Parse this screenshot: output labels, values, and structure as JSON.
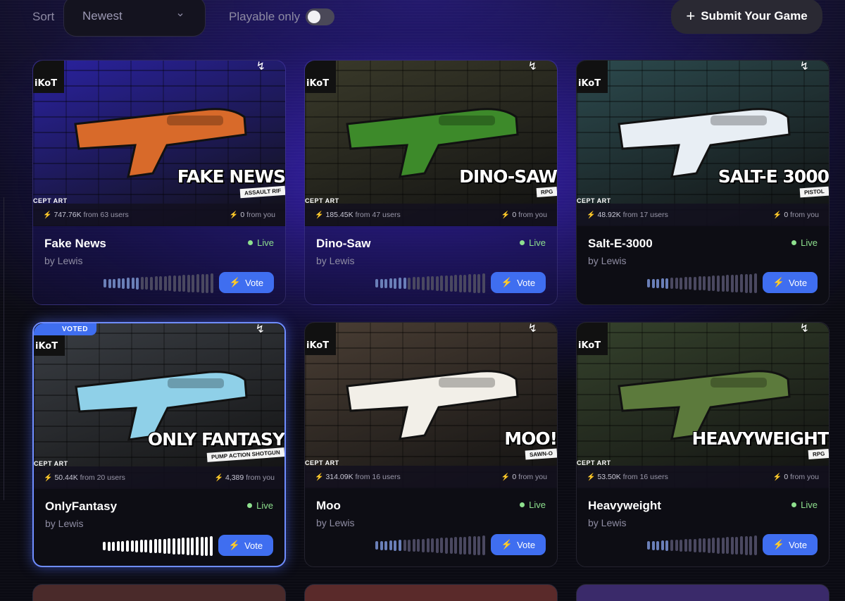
{
  "toolbar": {
    "sort_label": "Sort",
    "sort_value": "Newest",
    "playable_label": "Playable only",
    "playable_on": false,
    "submit_label": "Submit Your Game"
  },
  "cards": [
    {
      "title": "Fake News",
      "author": "by Lewis",
      "status": "Live",
      "art_title": "FAKE NEWS",
      "art_subtitle": "ASSAULT RIF",
      "corner_text": "CEPT ART",
      "stat_total": "747.76K",
      "stat_users": "from 63 users",
      "stat_you": "0",
      "stat_you_label": "from you",
      "vote_label": "Vote",
      "voted": false,
      "vote_level": 0.35,
      "bg": "#2a22a0"
    },
    {
      "title": "Dino-Saw",
      "author": "by Lewis",
      "status": "Live",
      "art_title": "DINO-SAW",
      "art_subtitle": "RPG",
      "corner_text": "CEPT ART",
      "stat_total": "185.45K",
      "stat_users": "from 47 users",
      "stat_you": "0",
      "stat_you_label": "from you",
      "vote_label": "Vote",
      "voted": false,
      "vote_level": 0.3,
      "bg": "#3a3a2a"
    },
    {
      "title": "Salt-E-3000",
      "author": "by Lewis",
      "status": "Live",
      "art_title": "SALT-E 3000",
      "art_subtitle": "PISTOL",
      "corner_text": "CEPT ART",
      "stat_total": "48.92K",
      "stat_users": "from 17 users",
      "stat_you": "0",
      "stat_you_label": "from you",
      "vote_label": "Vote",
      "voted": false,
      "vote_level": 0.2,
      "bg": "#2c4a4e"
    },
    {
      "title": "OnlyFantasy",
      "author": "by Lewis",
      "status": "Live",
      "art_title": "ONLY FANTASY",
      "art_subtitle": "PUMP ACTION SHOTGUN",
      "corner_text": "CEPT ART",
      "stat_total": "50.44K",
      "stat_users": "from 20 users",
      "stat_you": "4,389",
      "stat_you_label": "from you",
      "vote_label": "Vote",
      "voted": true,
      "voted_badge": "VOTED",
      "vote_level": 1.0,
      "bg": "#3a3e44"
    },
    {
      "title": "Moo",
      "author": "by Lewis",
      "status": "Live",
      "art_title": "MOO!",
      "art_subtitle": "SAWN-O",
      "corner_text": "CEPT ART",
      "stat_total": "314.09K",
      "stat_users": "from 16 users",
      "stat_you": "0",
      "stat_you_label": "from you",
      "vote_label": "Vote",
      "voted": false,
      "vote_level": 0.25,
      "bg": "#4a3e34"
    },
    {
      "title": "Heavyweight",
      "author": "by Lewis",
      "status": "Live",
      "art_title": "HEAVYWEIGHT",
      "art_subtitle": "RPG",
      "corner_text": "CEPT ART",
      "stat_total": "53.50K",
      "stat_users": "from 16 users",
      "stat_you": "0",
      "stat_you_label": "from you",
      "vote_label": "Vote",
      "voted": false,
      "vote_level": 0.2,
      "bg": "#35422c"
    }
  ]
}
